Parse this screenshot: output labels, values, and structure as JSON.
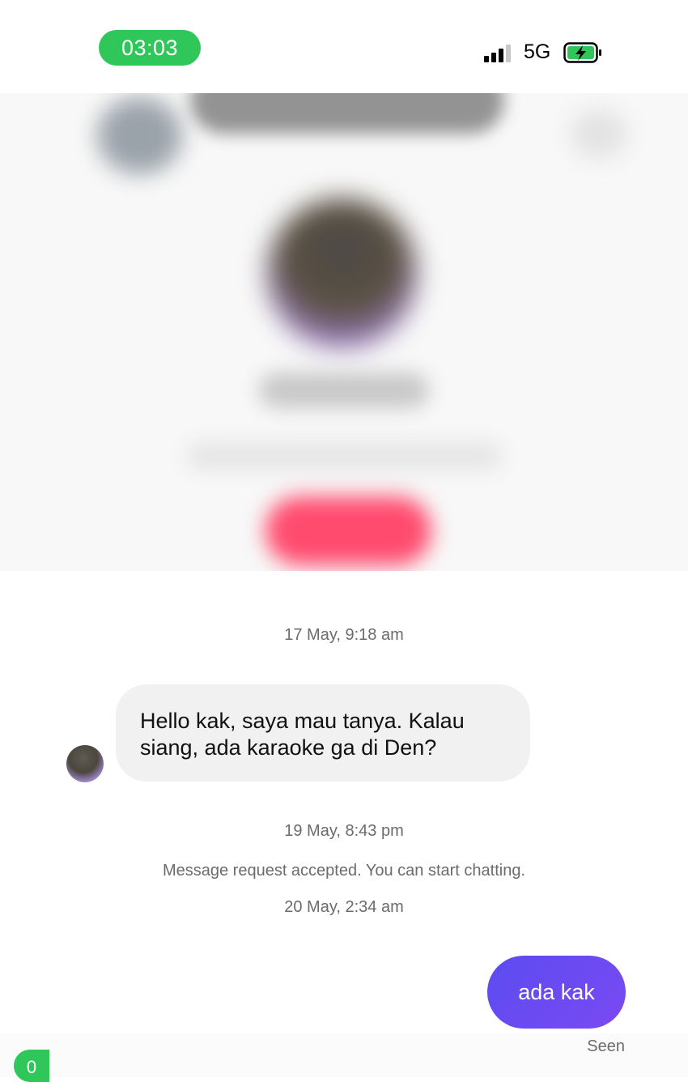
{
  "status_bar": {
    "time": "03:03",
    "network": "5G",
    "icons": [
      "signal-bars-icon",
      "charging-battery-icon"
    ],
    "colors": {
      "time_pill": "#2fc75a",
      "battery_fill": "#2fc75a"
    }
  },
  "chat": {
    "timestamp_1": "17 May, 9:18 am",
    "incoming_message": {
      "line_1": "Hello kak, saya mau tanya. Kalau",
      "line_2": "siang, ada karaoke ga di Den?"
    },
    "timestamp_2": "19 May, 8:43 pm",
    "system_message": "Message request accepted. You can start chatting.",
    "timestamp_3": "20 May, 2:34 am",
    "outgoing_message": "ada kak",
    "seen_label": "Seen",
    "colors": {
      "outgoing_bubble": "#6a4cf2",
      "incoming_bubble": "#f1f1f2"
    }
  },
  "bottom_indicator": {
    "text": "0"
  }
}
